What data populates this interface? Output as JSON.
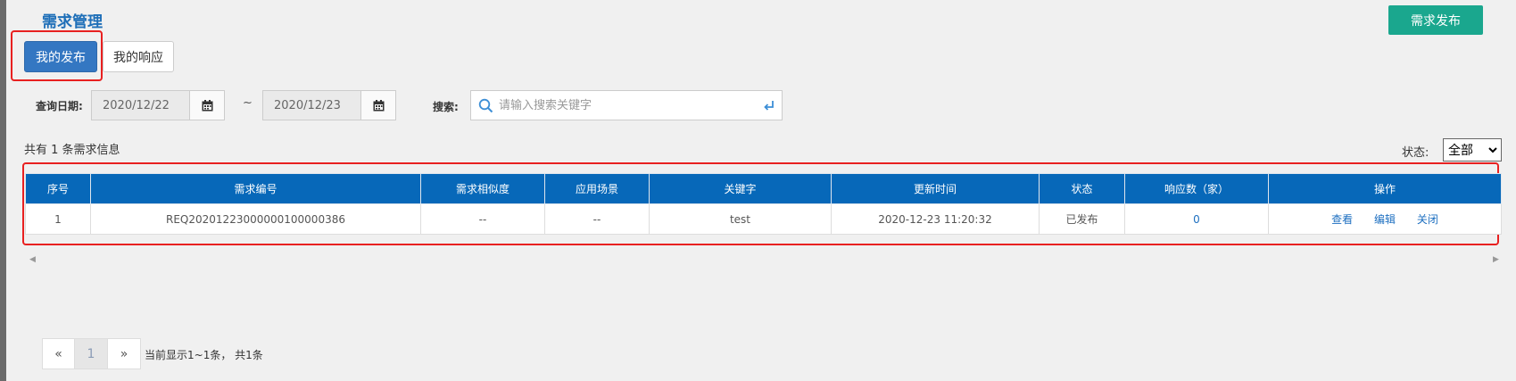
{
  "page": {
    "title": "需求管理",
    "publish_button": "需求发布"
  },
  "tabs": [
    {
      "label": "我的发布",
      "active": true
    },
    {
      "label": "我的响应",
      "active": false
    }
  ],
  "filters": {
    "date_label": "查询日期:",
    "date_from": "2020/12/22",
    "date_separator": "~",
    "date_to": "2020/12/23",
    "search_label": "搜索:",
    "search_placeholder": "请输入搜索关键字"
  },
  "summary": {
    "count_text": "共有 1 条需求信息",
    "status_label": "状态:",
    "status_value": "全部"
  },
  "table": {
    "headers": [
      "序号",
      "需求编号",
      "需求相似度",
      "应用场景",
      "关键字",
      "更新时间",
      "状态",
      "响应数（家）",
      "操作"
    ],
    "rows": [
      {
        "index": "1",
        "req_no": "REQ20201223000000100000386",
        "similarity": "--",
        "scenario": "--",
        "keyword": "test",
        "updated": "2020-12-23 11:20:32",
        "status": "已发布",
        "responses": "0",
        "actions": [
          "查看",
          "编辑",
          "关闭"
        ]
      }
    ]
  },
  "pagination": {
    "prev": "«",
    "current": "1",
    "next": "»",
    "info": "当前显示1~1条， 共1条"
  },
  "colors": {
    "header_bg": "#0768b9",
    "primary_tab": "#3477c2",
    "publish_button": "#1aa78e",
    "highlight_border": "#e82020",
    "link": "#1d6fc0"
  }
}
